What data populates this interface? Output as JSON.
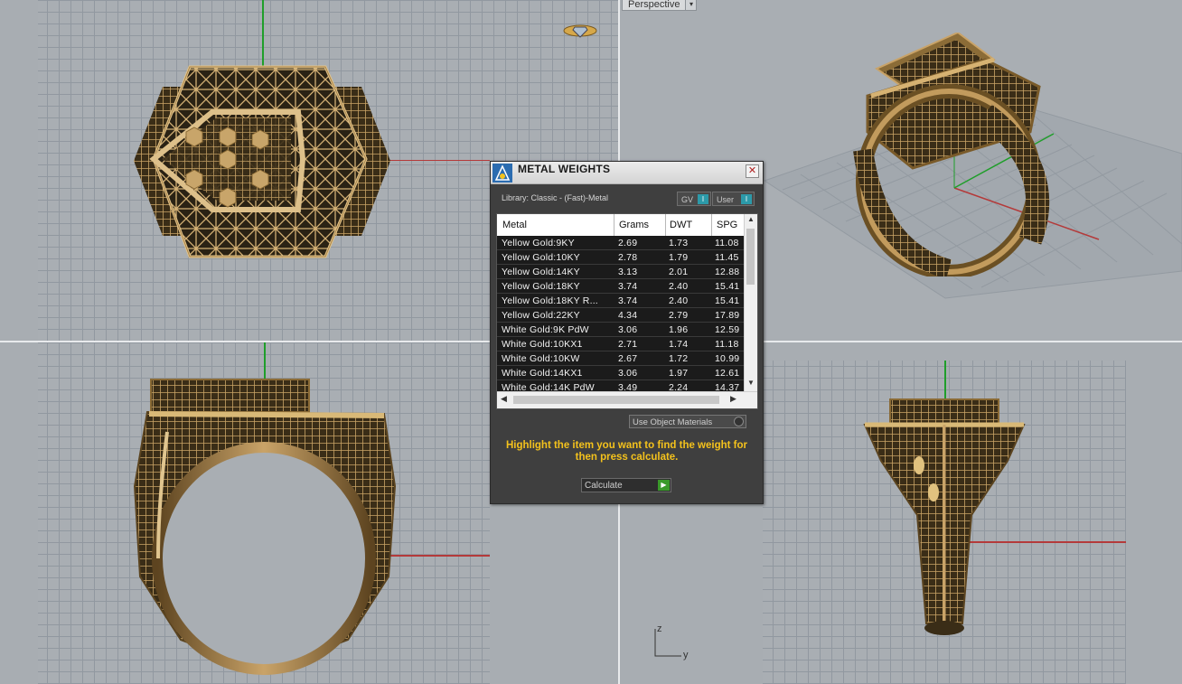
{
  "viewports": {
    "perspective_label": "Perspective"
  },
  "axes_indicator": {
    "z": "z",
    "y": "y"
  },
  "dialog": {
    "title": "METAL WEIGHTS",
    "library": "Library: Classic - (Fast)-Metal",
    "toggle_gv": "GV",
    "toggle_user": "User",
    "toggle_indicator": "I",
    "columns": [
      "Metal",
      "Grams",
      "DWT",
      "SPG"
    ],
    "rows": [
      [
        "Yellow Gold:9KY",
        "2.69",
        "1.73",
        "11.08"
      ],
      [
        "Yellow Gold:10KY",
        "2.78",
        "1.79",
        "11.45"
      ],
      [
        "Yellow Gold:14KY",
        "3.13",
        "2.01",
        "12.88"
      ],
      [
        "Yellow Gold:18KY",
        "3.74",
        "2.40",
        "15.41"
      ],
      [
        "Yellow Gold:18KY R...",
        "3.74",
        "2.40",
        "15.41"
      ],
      [
        "Yellow Gold:22KY",
        "4.34",
        "2.79",
        "17.89"
      ],
      [
        "White Gold:9K PdW",
        "3.06",
        "1.96",
        "12.59"
      ],
      [
        "White Gold:10KX1",
        "2.71",
        "1.74",
        "11.18"
      ],
      [
        "White Gold:10KW",
        "2.67",
        "1.72",
        "10.99"
      ],
      [
        "White Gold:14KX1",
        "3.06",
        "1.97",
        "12.61"
      ],
      [
        "White Gold:14K PdW",
        "3.49",
        "2.24",
        "14.37"
      ]
    ],
    "use_object_materials": "Use Object Materials",
    "message": "Highlight the item you want to find the weight for then press calculate.",
    "calculate": "Calculate"
  },
  "colors": {
    "gold": "#a07a3c",
    "gold_light": "#d7b678",
    "message": "#f4c21c",
    "axis_green": "#1f9e2a",
    "axis_red": "#b43a3a"
  }
}
